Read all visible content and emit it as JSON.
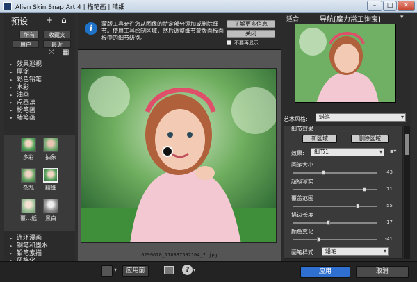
{
  "window": {
    "app_title": "Alien Skin Snap Art 4",
    "preset_title": "描笔画",
    "preset_sub": "晴细",
    "min": "–",
    "max": "□",
    "close": "✕"
  },
  "left": {
    "title": "预设",
    "add_icon": "+",
    "home_icon": "⌂",
    "seg_all": "所有",
    "seg_fav": "收藏夹",
    "seg_user": "用户",
    "seg_recent": "最近",
    "tree": [
      {
        "arrow": "▸",
        "label": "效果巡视"
      },
      {
        "arrow": "▸",
        "label": "厚涂"
      },
      {
        "arrow": "▸",
        "label": "彩色铅笔"
      },
      {
        "arrow": "▸",
        "label": "水彩"
      },
      {
        "arrow": "▸",
        "label": "油画"
      },
      {
        "arrow": "▸",
        "label": "点画法"
      },
      {
        "arrow": "▸",
        "label": "粉笔画"
      },
      {
        "arrow": "▾",
        "label": "蜡笔画"
      }
    ],
    "thumbs": [
      {
        "label": "多彩"
      },
      {
        "label": "抽象"
      },
      {
        "label": "杂乱"
      },
      {
        "label": "精细"
      },
      {
        "label": "覆…纸"
      },
      {
        "label": "黑白"
      }
    ],
    "tree2": [
      {
        "arrow": "▸",
        "label": "连环漫画"
      },
      {
        "arrow": "▸",
        "label": "钢笔和墨水"
      },
      {
        "arrow": "▸",
        "label": "铅笔素描"
      },
      {
        "arrow": "▸",
        "label": "风格化"
      }
    ]
  },
  "info": {
    "icon": "i",
    "text": "蒙版工具允许您从图像的特定部分添加或删除细节。使用工具绘制区域，然后调整细节蒙版面板面板中的细节级别。",
    "learn_more": "了解更多信息",
    "close": "关闭",
    "dont_show": "不要再显示"
  },
  "canvas": {
    "filename": "6299678_110837592104_2.jpg"
  },
  "right": {
    "fit": "适合",
    "nav_title": "导航[魔力常工询宝]",
    "style_label": "艺术风格:",
    "style_value": "蜡笔",
    "section": "细节效果",
    "btn_region": "新区域",
    "btn_delete": "删除区域",
    "effect_label": "效果:",
    "effect_value": "细节1",
    "sliders": [
      {
        "label": "画笔大小",
        "value": -43,
        "fraction": 0.36
      },
      {
        "label": "超级写实",
        "value": 71,
        "fraction": 0.86
      },
      {
        "label": "覆盖范围",
        "value": 55,
        "fraction": 0.78
      },
      {
        "label": "描边长度",
        "value": -17,
        "fraction": 0.42
      },
      {
        "label": "颜色变化",
        "value": -41,
        "fraction": 0.3
      }
    ],
    "brush_label": "画笔样式",
    "brush_value": "蜡笔"
  },
  "bottom": {
    "apply_preset": "应用前",
    "help": "?",
    "apply": "应用",
    "cancel": "取消"
  },
  "colors": {
    "apply_btn": "#2f6fd0",
    "accent_select": "#e8f2ff"
  }
}
